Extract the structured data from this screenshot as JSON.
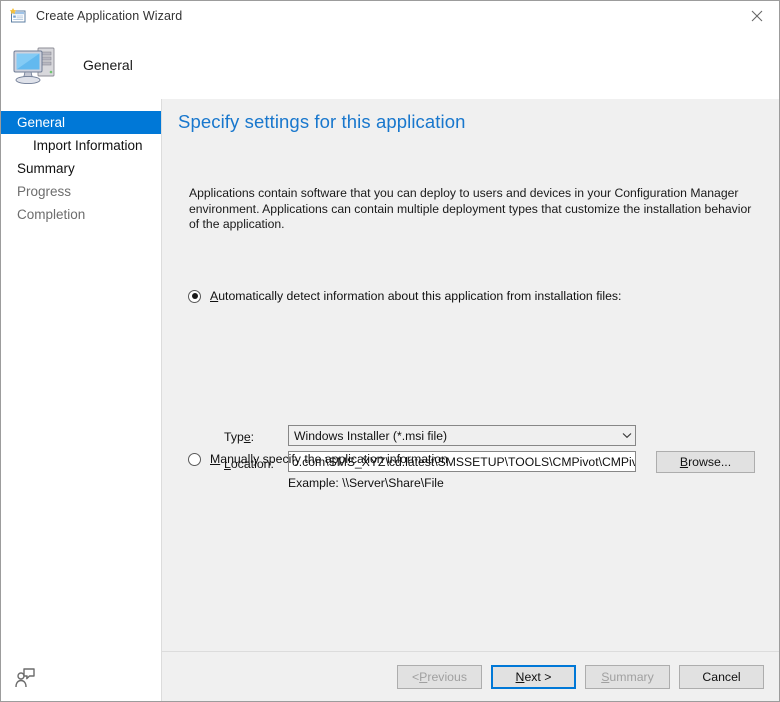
{
  "window": {
    "title": "Create Application Wizard",
    "title_icon": "wizard-window-icon",
    "close_label": "Close"
  },
  "header": {
    "title": "General",
    "icon": "computer-icon"
  },
  "sidebar": {
    "items": [
      {
        "label": "General",
        "state": "active"
      },
      {
        "label": "Import Information",
        "state": "enabled"
      },
      {
        "label": "Summary",
        "state": "enabled"
      },
      {
        "label": "Progress",
        "state": "disabled"
      },
      {
        "label": "Completion",
        "state": "disabled"
      }
    ]
  },
  "main": {
    "page_title": "Specify settings for this application",
    "description": "Applications contain software that you can deploy to users and devices in your Configuration Manager environment. Applications can contain multiple deployment types that customize the installation behavior of the application.",
    "option_auto": {
      "accel": "A",
      "label_rest": "utomatically detect information about this application from installation files:",
      "selected": true
    },
    "option_manual": {
      "accel": "M",
      "label_rest": "anually specify the application information",
      "selected": false
    },
    "type_field": {
      "label_pre": "Typ",
      "label_accel": "e",
      "label_post": ":",
      "value": "Windows Installer (*.msi file)",
      "arrow_icon": "chevron-down-icon"
    },
    "location_field": {
      "label_accel": "L",
      "label_rest": "ocation:",
      "value": "o.com\\SMS_XYZ\\cd.latest\\SMSSETUP\\TOOLS\\CMPivot\\CMPivot.msi",
      "example": "Example: \\\\Server\\Share\\File"
    },
    "browse_button": {
      "accel": "B",
      "label_rest": "rowse..."
    }
  },
  "footer": {
    "feedback_icon": "feedback-person-icon",
    "buttons": [
      {
        "name": "previous",
        "label": "< Previous",
        "accel": "P",
        "pre": "< ",
        "rest": "revious",
        "disabled": true,
        "focused": false
      },
      {
        "name": "next",
        "label": "Next >",
        "accel": "N",
        "pre": "",
        "rest": "ext >",
        "disabled": false,
        "focused": true
      },
      {
        "name": "summary",
        "label": "Summary",
        "accel": "S",
        "pre": "",
        "rest": "ummary",
        "disabled": true,
        "focused": false
      },
      {
        "name": "cancel",
        "label": "Cancel",
        "accel": "",
        "pre": "Cancel",
        "rest": "",
        "disabled": false,
        "focused": false
      }
    ]
  },
  "colors": {
    "accent": "#0078d7",
    "title_blue": "#1877cd",
    "panel_bg": "#f0f0f0",
    "sidebar_bg": "#ffffff"
  }
}
